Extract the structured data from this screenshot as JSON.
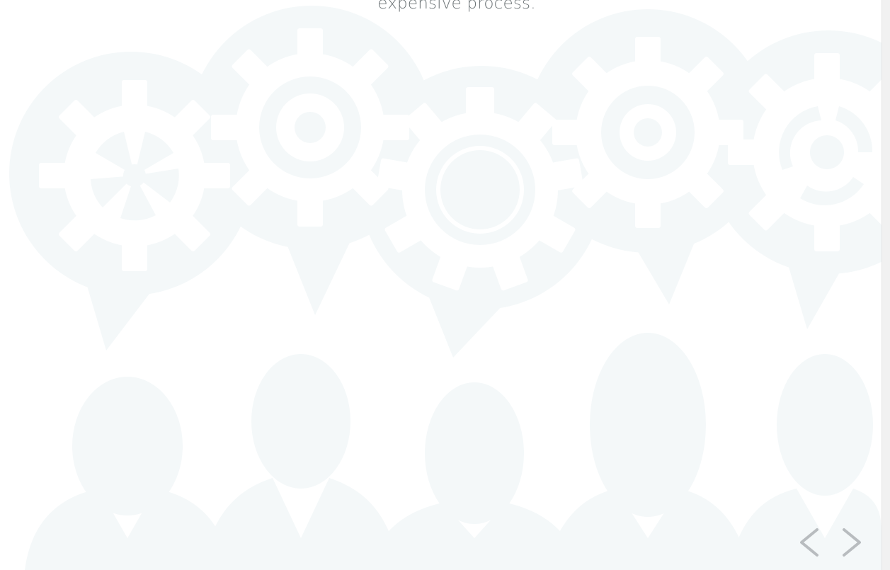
{
  "slide": {
    "caption_tail": "expensive process."
  },
  "controls": {
    "prev_icon": "chevron-left-icon",
    "next_icon": "chevron-right-icon"
  },
  "colors": {
    "background": "#ffffff",
    "silhouette": "#f4f8f9",
    "gear_cutout": "#ffffff",
    "caption_text": "#6d7477",
    "arrow": "#b8bcbf",
    "scrollbar_track": "#f1f1f1"
  }
}
